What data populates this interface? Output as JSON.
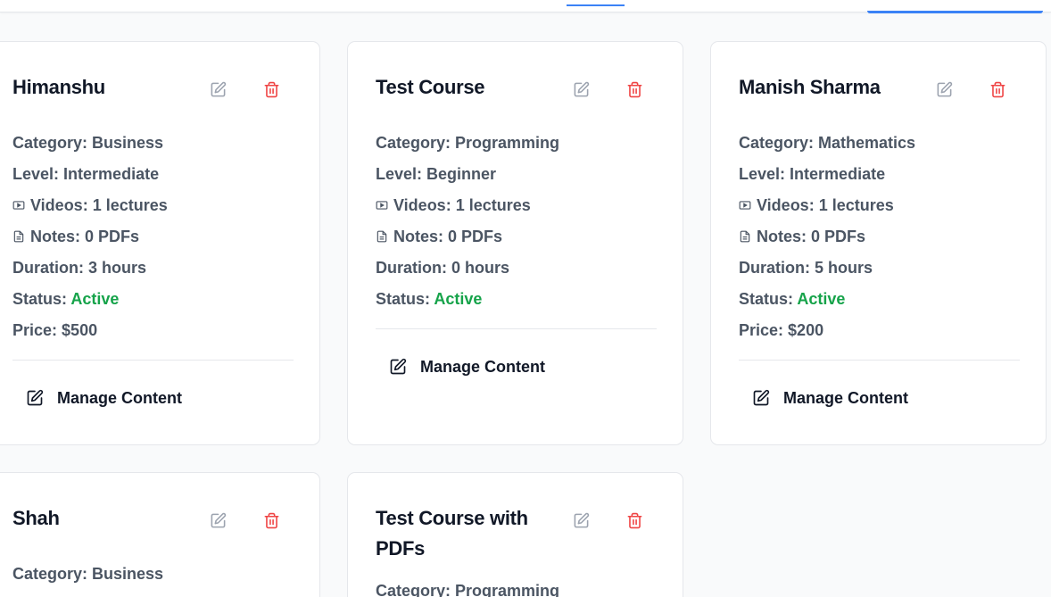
{
  "labels": {
    "category": "Category:",
    "level": "Level:",
    "videos": "Videos:",
    "notes": "Notes:",
    "duration": "Duration:",
    "status": "Status:",
    "price": "Price:",
    "manage_content": "Manage Content"
  },
  "courses": [
    {
      "title": "Himanshu",
      "category": "Business",
      "level": "Intermediate",
      "videos": "1 lectures",
      "notes": "0 PDFs",
      "duration": "3 hours",
      "status": "Active",
      "price": "$500"
    },
    {
      "title": "Test Course",
      "category": "Programming",
      "level": "Beginner",
      "videos": "1 lectures",
      "notes": "0 PDFs",
      "duration": "0 hours",
      "status": "Active"
    },
    {
      "title": "Manish Sharma",
      "category": "Mathematics",
      "level": "Intermediate",
      "videos": "1 lectures",
      "notes": "0 PDFs",
      "duration": "5 hours",
      "status": "Active",
      "price": "$200"
    },
    {
      "title": "Shah",
      "category": "Business"
    },
    {
      "title_line1": "Test Course with",
      "title_line2": "PDFs",
      "category": "Programming"
    }
  ],
  "colors": {
    "accent": "#3b82f6",
    "status_active": "#16a34a",
    "delete": "#ef4444",
    "edit": "#9ca3af"
  },
  "icons": [
    "edit-icon",
    "trash-icon",
    "video-icon",
    "document-icon"
  ]
}
